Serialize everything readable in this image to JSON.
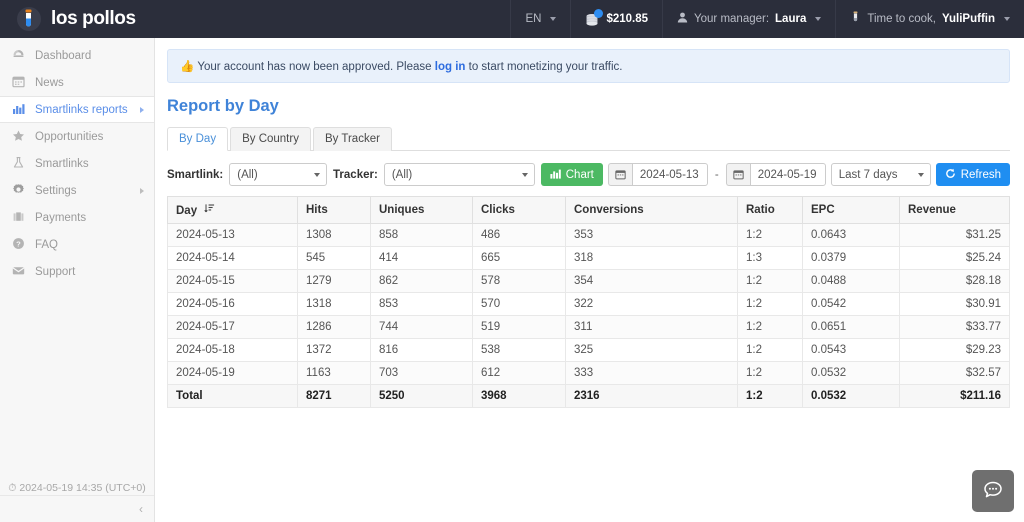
{
  "topbar": {
    "brand": "los pollos",
    "language": "EN",
    "balance": "$210.85",
    "manager_prefix": "Your manager:",
    "manager_name": "Laura",
    "user_prefix": "Time to cook,",
    "user_name": "YuliPuffin"
  },
  "sidebar": {
    "items": [
      {
        "label": "Dashboard",
        "icon": "dashboard-icon",
        "glyph": "◔",
        "active": false,
        "arrow": false
      },
      {
        "label": "News",
        "icon": "calendar-icon",
        "glyph": "☷",
        "active": false,
        "arrow": false
      },
      {
        "label": "Smartlinks reports",
        "icon": "bar-chart-icon",
        "glyph": "ὌA",
        "active": true,
        "arrow": true
      },
      {
        "label": "Opportunities",
        "icon": "star-icon",
        "glyph": "★",
        "active": false,
        "arrow": false
      },
      {
        "label": "Smartlinks",
        "icon": "flask-icon",
        "glyph": "⚗",
        "active": false,
        "arrow": false
      },
      {
        "label": "Settings",
        "icon": "gear-icon",
        "glyph": "⚙",
        "active": false,
        "arrow": true
      },
      {
        "label": "Payments",
        "icon": "briefcase-icon",
        "glyph": "▤",
        "active": false,
        "arrow": false
      },
      {
        "label": "FAQ",
        "icon": "question-circle-icon",
        "glyph": "?",
        "active": false,
        "arrow": false
      },
      {
        "label": "Support",
        "icon": "envelope-icon",
        "glyph": "✉",
        "active": false,
        "arrow": false
      }
    ],
    "footer_time": "2024-05-19 14:35 (UTC+0)",
    "collapse_label": "‹"
  },
  "alert": {
    "icon": "thumbs-up-emoji",
    "emoji": "👍",
    "text_before": "Your account has now been approved. Please",
    "link": "log in",
    "text_after": "to start monetizing your traffic."
  },
  "page": {
    "title": "Report by Day"
  },
  "tabs": [
    {
      "label": "By Day",
      "active": true
    },
    {
      "label": "By Country",
      "active": false
    },
    {
      "label": "By Tracker",
      "active": false
    }
  ],
  "filters": {
    "smartlink_label": "Smartlink:",
    "smartlink_value": "(All)",
    "tracker_label": "Tracker:",
    "tracker_value": "(All)",
    "chart_button": "Chart",
    "date_from": "2024-05-13",
    "date_to": "2024-05-19",
    "date_separator": "-",
    "range_value": "Last 7 days",
    "refresh_button": "Refresh"
  },
  "table": {
    "columns": [
      "Day",
      "Hits",
      "Uniques",
      "Clicks",
      "Conversions",
      "Ratio",
      "EPC",
      "Revenue"
    ],
    "sort_column": "Day",
    "rows": [
      {
        "day": "2024-05-13",
        "hits": "1308",
        "uniques": "858",
        "clicks": "486",
        "conversions": "353",
        "ratio": "1:2",
        "epc": "0.0643",
        "revenue": "$31.25"
      },
      {
        "day": "2024-05-14",
        "hits": "545",
        "uniques": "414",
        "clicks": "665",
        "conversions": "318",
        "ratio": "1:3",
        "epc": "0.0379",
        "revenue": "$25.24"
      },
      {
        "day": "2024-05-15",
        "hits": "1279",
        "uniques": "862",
        "clicks": "578",
        "conversions": "354",
        "ratio": "1:2",
        "epc": "0.0488",
        "revenue": "$28.18"
      },
      {
        "day": "2024-05-16",
        "hits": "1318",
        "uniques": "853",
        "clicks": "570",
        "conversions": "322",
        "ratio": "1:2",
        "epc": "0.0542",
        "revenue": "$30.91"
      },
      {
        "day": "2024-05-17",
        "hits": "1286",
        "uniques": "744",
        "clicks": "519",
        "conversions": "311",
        "ratio": "1:2",
        "epc": "0.0651",
        "revenue": "$33.77"
      },
      {
        "day": "2024-05-18",
        "hits": "1372",
        "uniques": "816",
        "clicks": "538",
        "conversions": "325",
        "ratio": "1:2",
        "epc": "0.0543",
        "revenue": "$29.23"
      },
      {
        "day": "2024-05-19",
        "hits": "1163",
        "uniques": "703",
        "clicks": "612",
        "conversions": "333",
        "ratio": "1:2",
        "epc": "0.0532",
        "revenue": "$32.57"
      }
    ],
    "total": {
      "day": "Total",
      "hits": "8271",
      "uniques": "5250",
      "clicks": "3968",
      "conversions": "2316",
      "ratio": "1:2",
      "epc": "0.0532",
      "revenue": "$211.16"
    }
  },
  "chat": {
    "icon": "chat-bubble-icon"
  },
  "colors": {
    "topbar_bg": "#2b2e3b",
    "accent_blue": "#3f83d8",
    "link_blue": "#2d6cdf",
    "green": "#4cb963",
    "refresh_blue": "#1f8ef1",
    "sidebar_bg": "#f7f7f7",
    "alert_bg": "#e9f1fb"
  }
}
